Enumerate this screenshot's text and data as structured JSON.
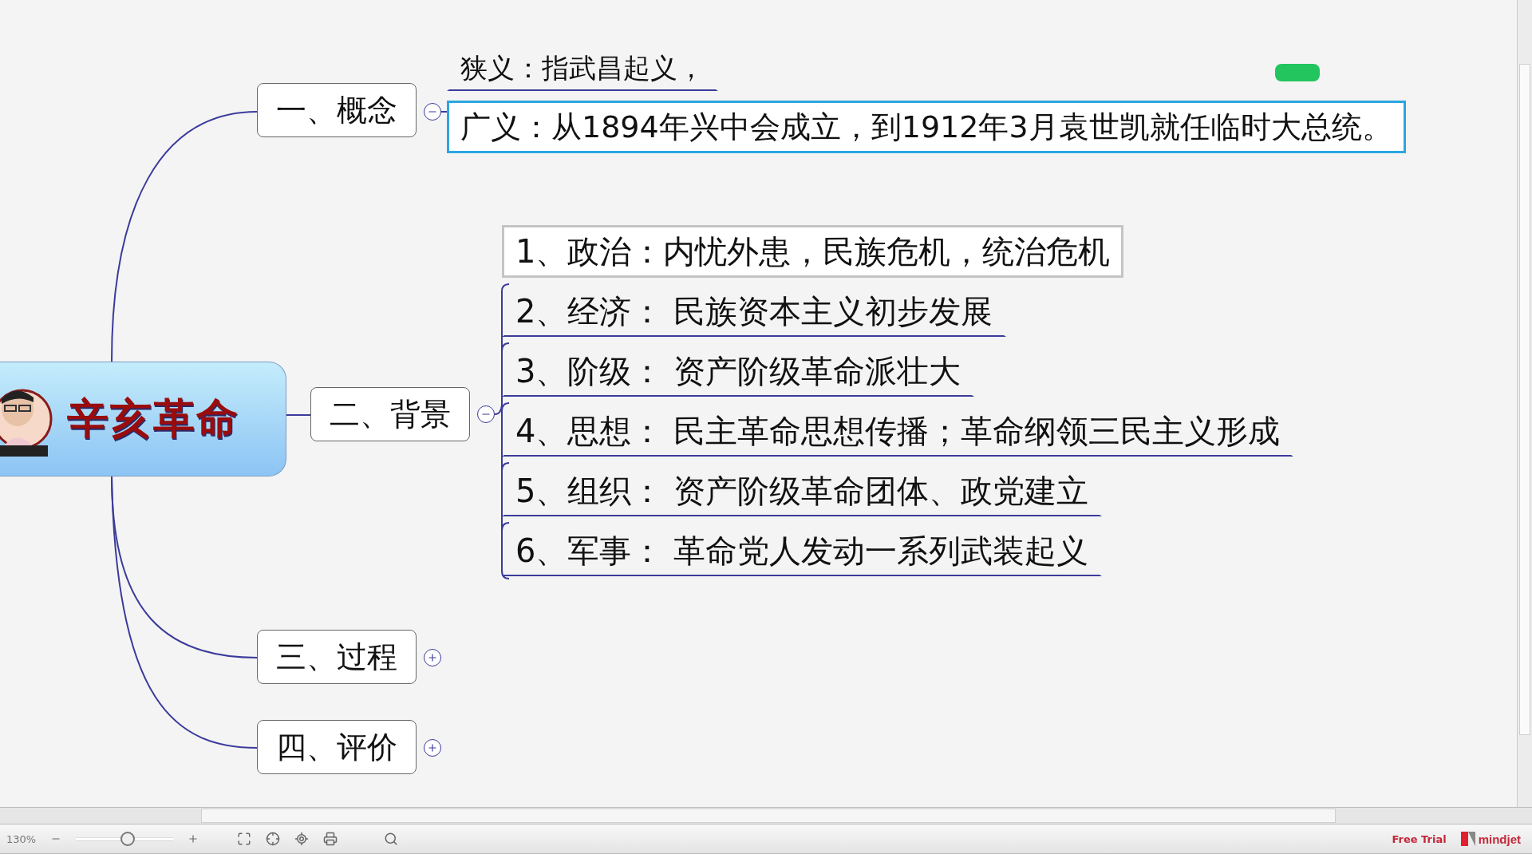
{
  "map": {
    "central": {
      "title": "辛亥革命"
    },
    "branches": [
      {
        "label": "一、概念",
        "collapsed": false,
        "children": [
          {
            "text": "狭义：指武昌起义，",
            "selected": false,
            "hovered": false
          },
          {
            "text": "广义：从1894年兴中会成立，到1912年3月袁世凯就任临时大总统。",
            "selected": true,
            "hovered": false
          }
        ]
      },
      {
        "label": "二、背景",
        "collapsed": false,
        "children": [
          {
            "text": "1、政治：内忧外患，民族危机，统治危机",
            "selected": false,
            "hovered": true
          },
          {
            "text": "2、经济： 民族资本主义初步发展",
            "selected": false,
            "hovered": false
          },
          {
            "text": "3、阶级： 资产阶级革命派壮大",
            "selected": false,
            "hovered": false
          },
          {
            "text": "4、思想： 民主革命思想传播；革命纲领三民主义形成",
            "selected": false,
            "hovered": false
          },
          {
            "text": "5、组织： 资产阶级革命团体、政党建立",
            "selected": false,
            "hovered": false
          },
          {
            "text": "6、军事： 革命党人发动一系列武装起义",
            "selected": false,
            "hovered": false
          }
        ]
      },
      {
        "label": "三、过程",
        "collapsed": true
      },
      {
        "label": "四、评价",
        "collapsed": true
      }
    ]
  },
  "status_bar": {
    "zoom": "130%",
    "zoom_slider": {
      "level": 0.54
    },
    "trial": "Free Trial",
    "brand": "mindjet"
  }
}
